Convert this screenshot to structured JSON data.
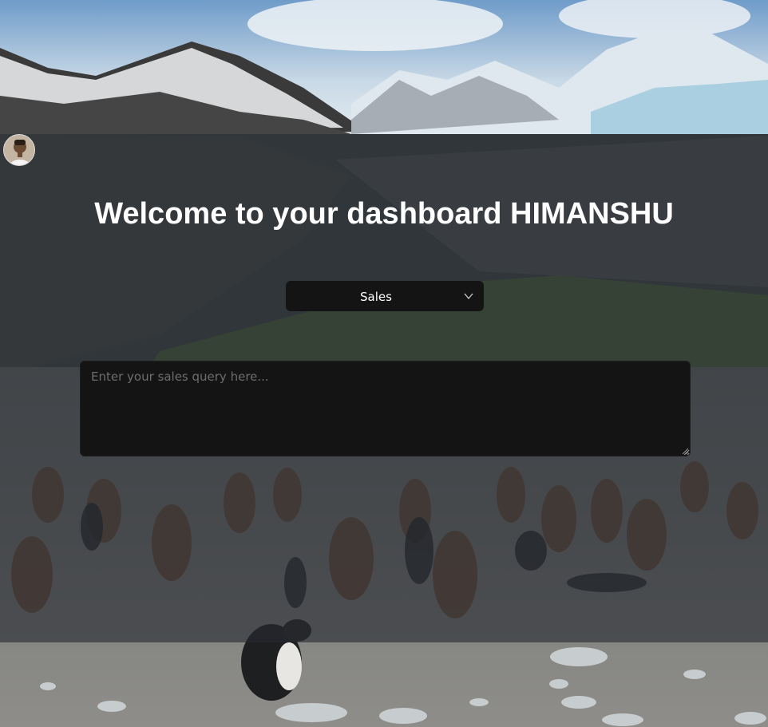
{
  "user": {
    "avatar_icon": "user-avatar-photo"
  },
  "header": {
    "title": "Welcome to your dashboard HIMANSHU"
  },
  "category_select": {
    "selected": "Sales",
    "icon": "chevron-down-icon"
  },
  "query": {
    "placeholder": "Enter your sales query here...",
    "value": ""
  },
  "colors": {
    "overlay": "#262a30",
    "control_bg": "#141414",
    "title_text": "#ffffff",
    "placeholder_text": "#6d6d6d"
  },
  "background": {
    "description_icon": "mountain-penguin-landscape"
  }
}
